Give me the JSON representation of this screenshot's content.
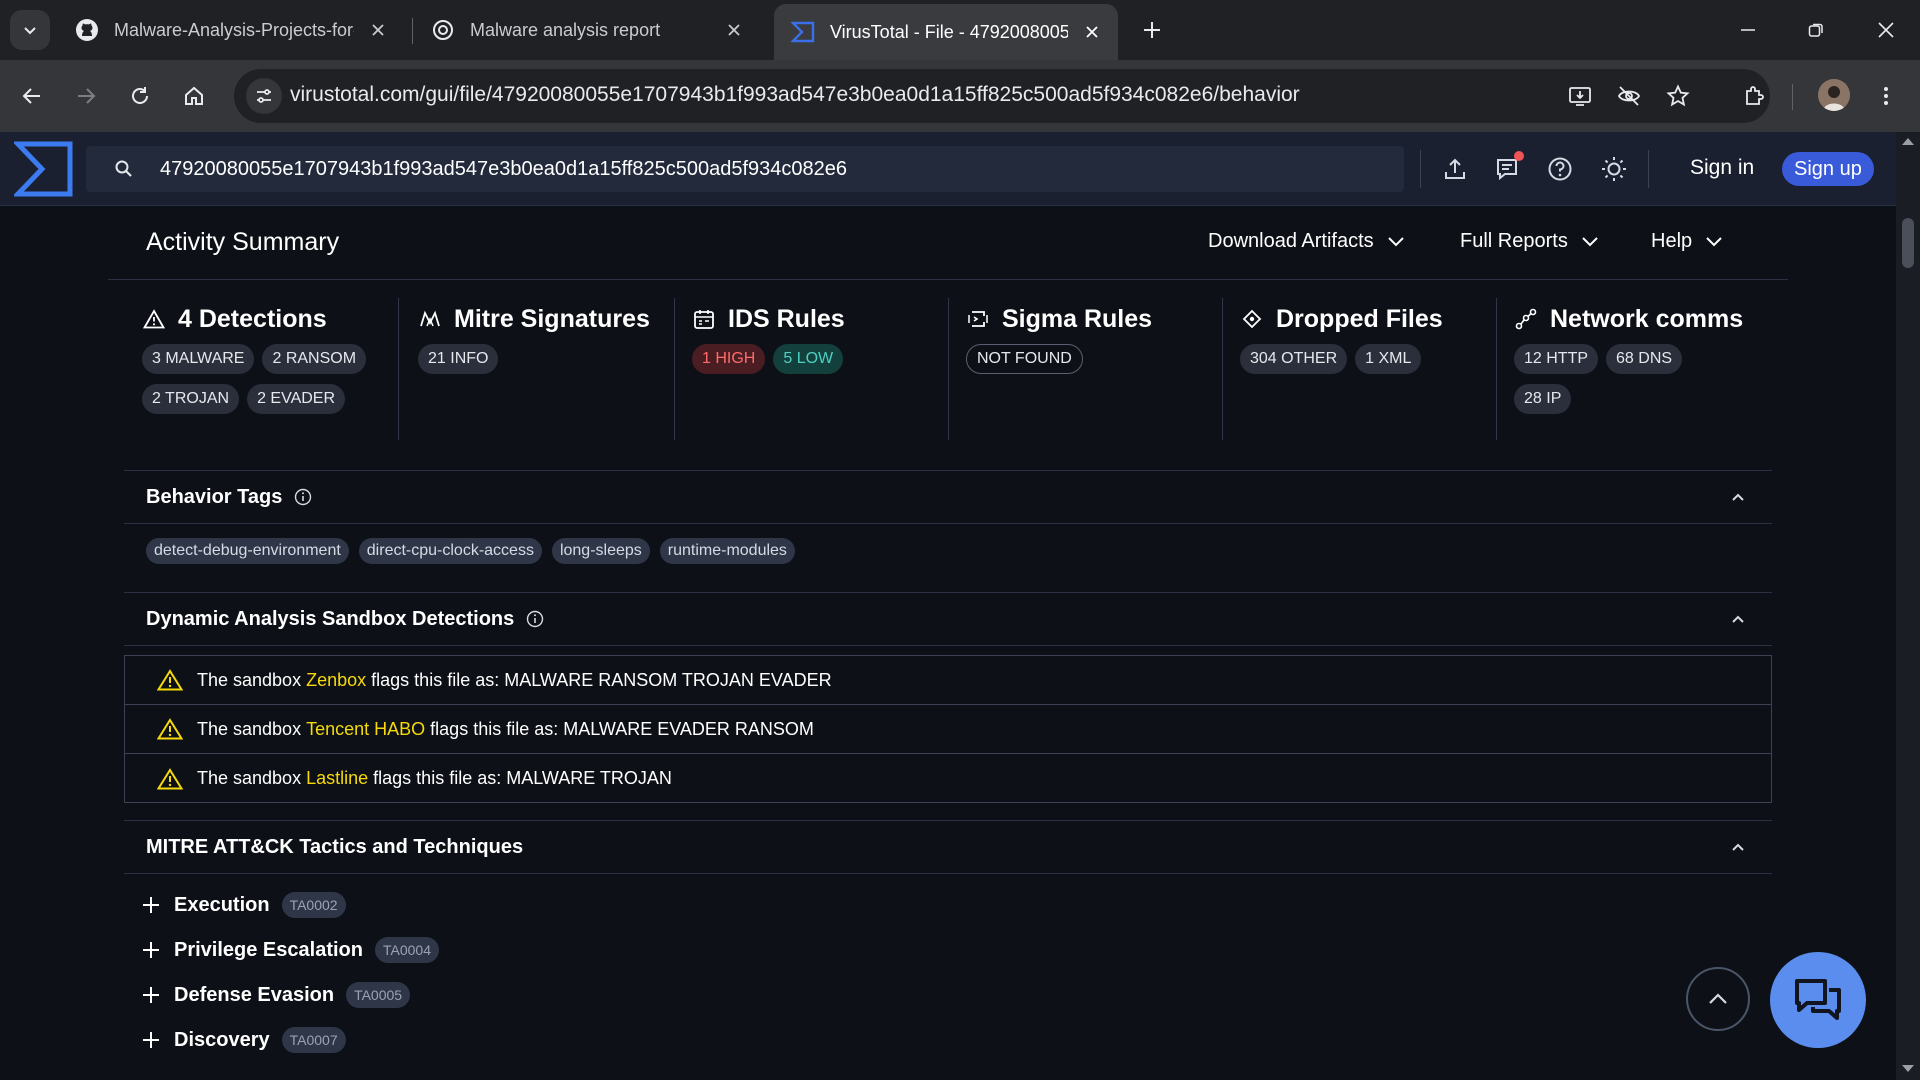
{
  "browser": {
    "tabs": [
      {
        "title": "Malware-Analysis-Projects-for-I",
        "favicon": "github-icon"
      },
      {
        "title": "Malware analysis report",
        "favicon": "openai-icon"
      },
      {
        "title": "VirusTotal - File - 47920080055",
        "favicon": "virustotal-icon",
        "active": true
      }
    ],
    "url": "virustotal.com/gui/file/47920080055e1707943b1f993ad547e3b0ea0d1a15ff825c500ad5f934c082e6/behavior"
  },
  "header": {
    "search_value": "47920080055e1707943b1f993ad547e3b0ea0d1a15ff825c500ad5f934c082e6",
    "signin_label": "Sign in",
    "signup_label": "Sign up",
    "accent_color": "#3a5bd9"
  },
  "summary": {
    "title": "Activity Summary",
    "menus": {
      "download": "Download Artifacts",
      "full_reports": "Full Reports",
      "help": "Help"
    },
    "stats": [
      {
        "title": "4 Detections",
        "icon": "warning-icon",
        "pills": [
          "3 MALWARE",
          "2 RANSOM",
          "2 TROJAN",
          "2 EVADER"
        ]
      },
      {
        "title": "Mitre Signatures",
        "icon": "mitre-icon",
        "pills": [
          "21 INFO"
        ]
      },
      {
        "title": "IDS Rules",
        "icon": "ids-icon",
        "pills": [
          "1 HIGH",
          "5 LOW"
        ]
      },
      {
        "title": "Sigma Rules",
        "icon": "sigma-icon",
        "pills": [
          "NOT FOUND"
        ]
      },
      {
        "title": "Dropped Files",
        "icon": "dropped-files-icon",
        "pills": [
          "304 OTHER",
          "1 XML"
        ]
      },
      {
        "title": "Network comms",
        "icon": "network-icon",
        "pills": [
          "12 HTTP",
          "68 DNS",
          "28 IP"
        ]
      }
    ]
  },
  "behavior_tags": {
    "title": "Behavior Tags",
    "tags": [
      "detect-debug-environment",
      "direct-cpu-clock-access",
      "long-sleeps",
      "runtime-modules"
    ]
  },
  "sandbox": {
    "title": "Dynamic Analysis Sandbox Detections",
    "prefix": "The sandbox",
    "rows": [
      {
        "name": "Zenbox",
        "text": "flags this file as: MALWARE RANSOM TROJAN EVADER"
      },
      {
        "name": "Tencent HABO",
        "text": "flags this file as: MALWARE EVADER RANSOM"
      },
      {
        "name": "Lastline",
        "text": "flags this file as: MALWARE TROJAN"
      }
    ]
  },
  "mitre": {
    "title": "MITRE ATT&CK Tactics and Techniques",
    "tactics": [
      {
        "name": "Execution",
        "id": "TA0002"
      },
      {
        "name": "Privilege Escalation",
        "id": "TA0004"
      },
      {
        "name": "Defense Evasion",
        "id": "TA0005"
      },
      {
        "name": "Discovery",
        "id": "TA0007"
      }
    ]
  }
}
